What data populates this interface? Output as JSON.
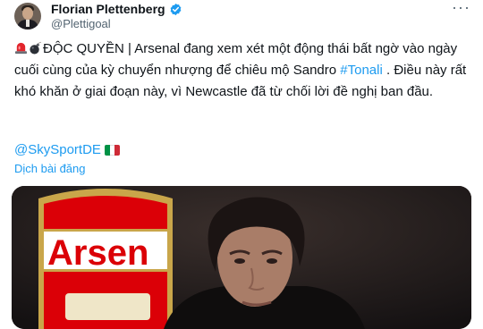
{
  "author": {
    "display_name": "Florian Plettenberg",
    "handle": "@Plettigoal"
  },
  "tweet": {
    "segment_1": "ĐỘC QUYỀN | Arsenal đang xem xét một động thái bất ngờ vào ngày cuối cùng của kỳ chuyển nhượng để chiêu mộ Sandro ",
    "hashtag": "#Tonali",
    "segment_2": " . Điều này rất khó khăn ở giai đoạn này, vì Newcastle đã từ chối lời đề nghị ban đầu.",
    "mention": "@SkySportDE"
  },
  "translate_label": "Dịch bài đăng",
  "media": {
    "crest_text": "Arsen",
    "flag_colors": [
      "#009246",
      "#ffffff",
      "#ce2b37"
    ]
  },
  "colors": {
    "link": "#1d9bf0",
    "text": "#0f1419",
    "secondary": "#536471",
    "arsenal_red": "#db0007"
  },
  "icons": [
    "verified-badge-icon",
    "more-options-icon",
    "siren-emoji-icon",
    "bomb-emoji-icon",
    "italy-flag-icon"
  ]
}
